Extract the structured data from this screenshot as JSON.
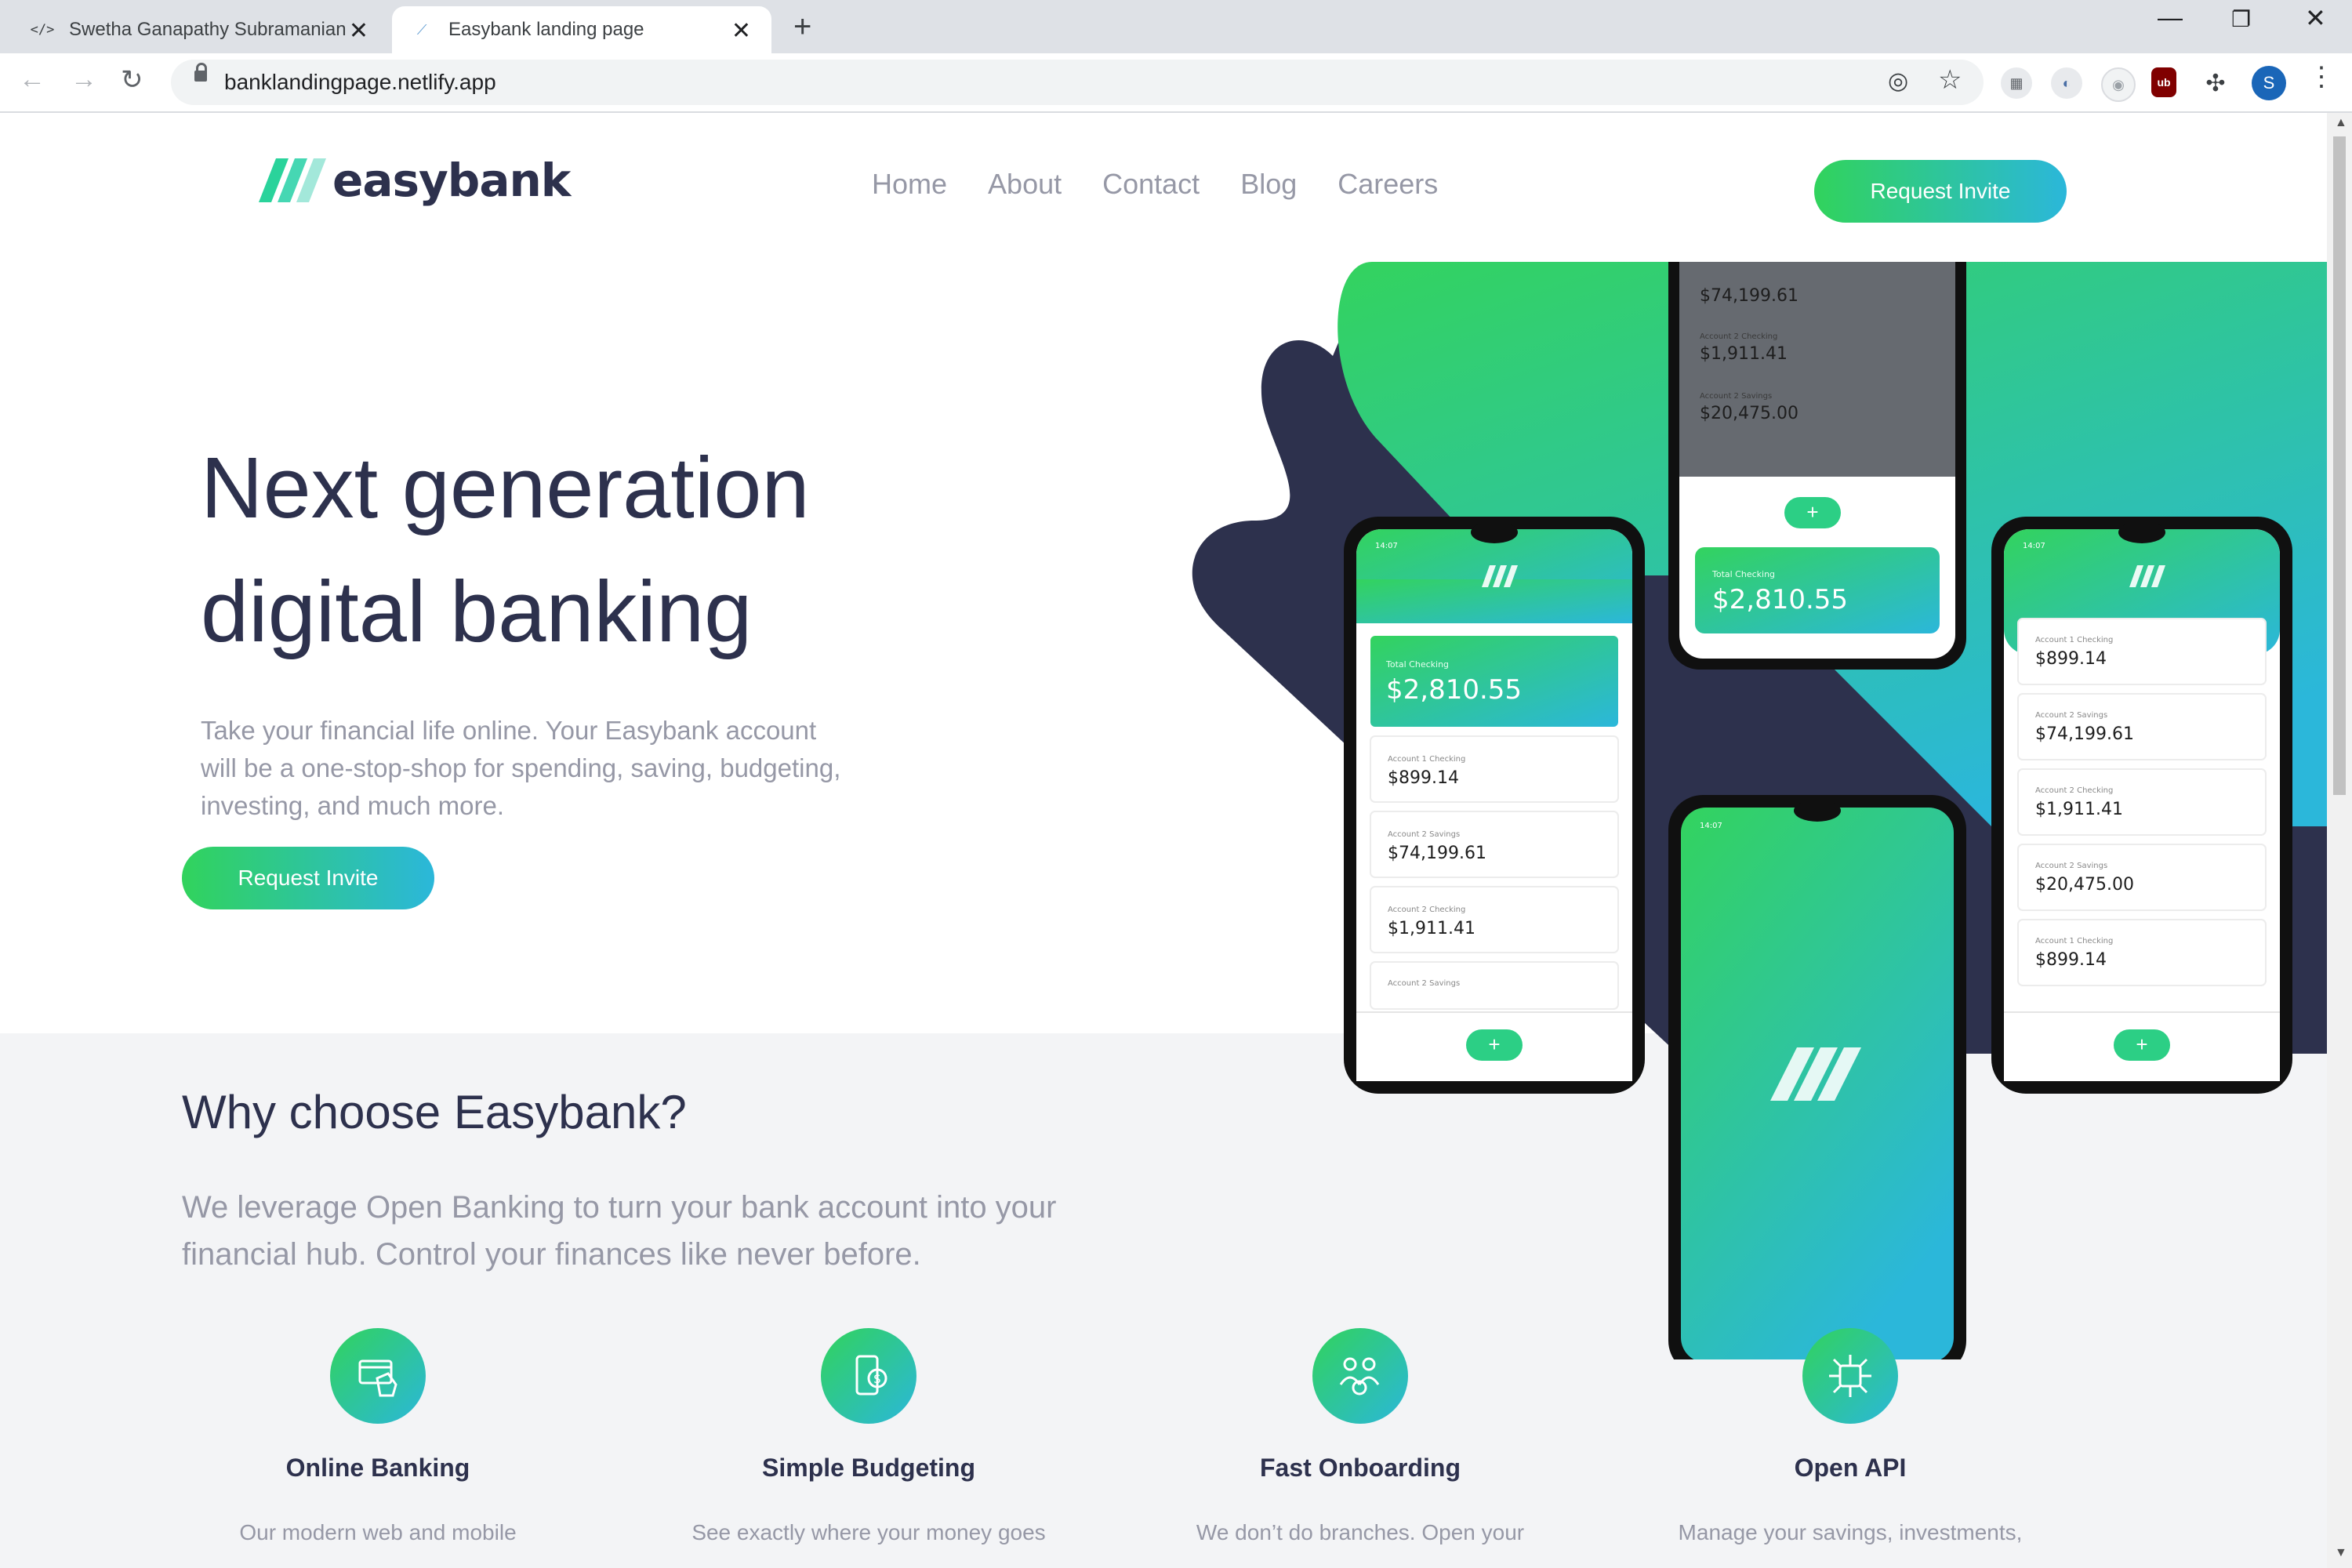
{
  "browser": {
    "tabs": [
      {
        "title": "Swetha Ganapathy Subramanian",
        "favicon": "code-icon"
      },
      {
        "title": "Easybank landing page",
        "favicon": "easybank-icon",
        "active": true
      }
    ],
    "url": "banklandingpage.netlify.app",
    "profile_initial": "S",
    "extension_ublock": "ub"
  },
  "site": {
    "logo_text": "easybank",
    "nav": [
      "Home",
      "About",
      "Contact",
      "Blog",
      "Careers"
    ],
    "cta_label": "Request Invite",
    "hero": {
      "title_line1": "Next generation",
      "title_line2": "digital banking",
      "subtitle": "Take your financial life online. Your Easybank account will be a one-stop-shop for spending, saving, budgeting, investing, and much more.",
      "cta_label": "Request Invite"
    },
    "why": {
      "title": "Why choose Easybank?",
      "subtitle": "We leverage Open Banking to turn your bank account into your financial hub. Control your finances like never before."
    },
    "features": [
      {
        "title": "Online Banking",
        "text": "Our modern web and mobile",
        "icon": "online-banking-icon"
      },
      {
        "title": "Simple Budgeting",
        "text": "See exactly where your money goes",
        "icon": "budgeting-icon"
      },
      {
        "title": "Fast Onboarding",
        "text": "We don’t do branches. Open your",
        "icon": "onboarding-icon"
      },
      {
        "title": "Open API",
        "text": "Manage your savings, investments,",
        "icon": "api-icon"
      }
    ]
  },
  "mockups": {
    "status_time": "14:07",
    "total_label": "Total Checking",
    "total_value": "$2,810.55",
    "accounts": [
      {
        "label": "Account 1 Checking",
        "value": "$899.14"
      },
      {
        "label": "Account 2 Savings",
        "value": "$74,199.61"
      },
      {
        "label": "Account 2 Checking",
        "value": "$1,911.41"
      },
      {
        "label": "Account 2 Savings",
        "value": "$20,475.00"
      },
      {
        "label": "Account 1 Checking",
        "value": "$899.14"
      }
    ]
  },
  "colors": {
    "dark_blue": "#2d314d",
    "lime_green": "#31d35c",
    "bright_cyan": "#2bb7da",
    "grayish_blue": "#9698a6",
    "light_gray": "#f3f4f6"
  }
}
